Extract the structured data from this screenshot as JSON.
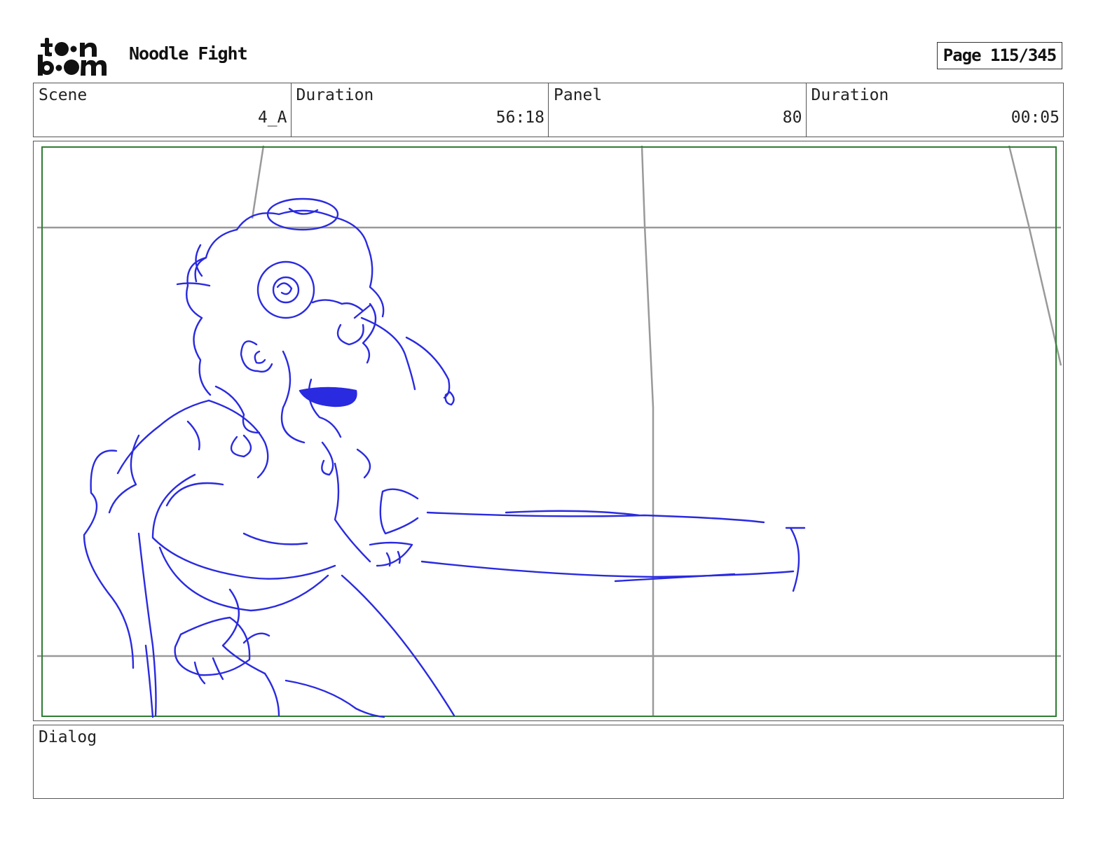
{
  "header": {
    "logo_text": "toon boom",
    "title": "Noodle Fight",
    "page_label": "Page 115/345"
  },
  "info": {
    "scene_label": "Scene",
    "scene_value": "4_A",
    "scene_duration_label": "Duration",
    "scene_duration_value": "56:18",
    "panel_label": "Panel",
    "panel_value": "80",
    "panel_duration_label": "Duration",
    "panel_duration_value": "00:05"
  },
  "panel": {
    "safe_frame_color": "#2e7d32",
    "guide_line_color": "#999999",
    "sketch_color": "#2a2ae0"
  },
  "dialog": {
    "label": "Dialog",
    "text": ""
  }
}
